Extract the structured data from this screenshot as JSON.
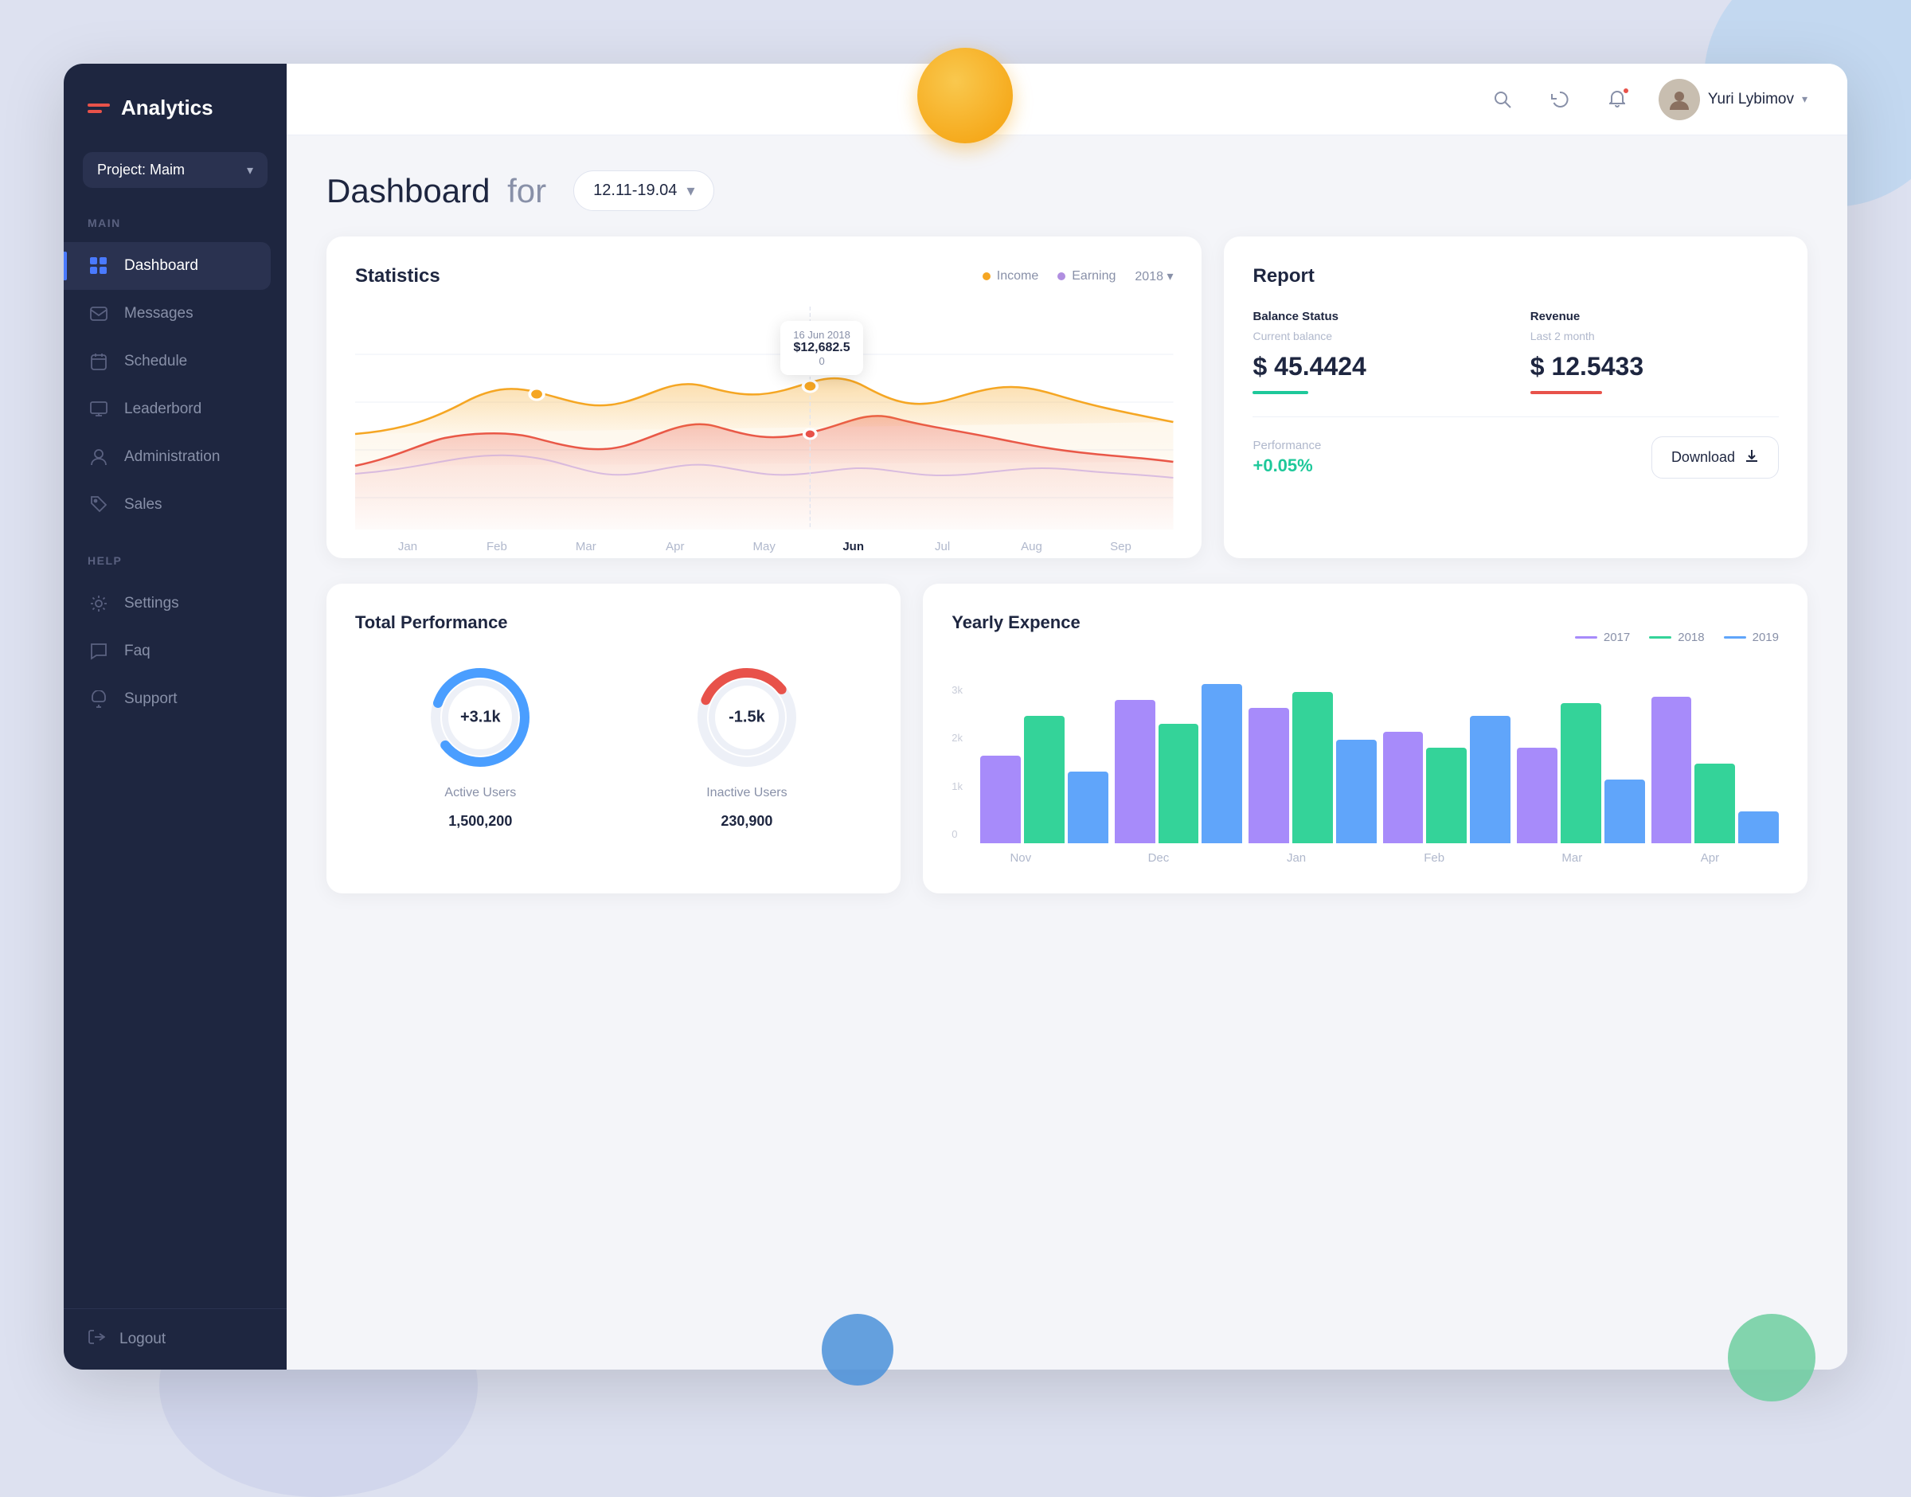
{
  "app": {
    "name": "Analytics",
    "project": "Project: Maim",
    "user": "Yuri Lybimov"
  },
  "sidebar": {
    "nav_main_label": "MAIN",
    "nav_help_label": "HELP",
    "items_main": [
      {
        "id": "dashboard",
        "label": "Dashboard",
        "icon": "grid"
      },
      {
        "id": "messages",
        "label": "Messages",
        "icon": "mail"
      },
      {
        "id": "schedule",
        "label": "Schedule",
        "icon": "calendar"
      },
      {
        "id": "leaderboard",
        "label": "Leaderbord",
        "icon": "monitor"
      },
      {
        "id": "administration",
        "label": "Administration",
        "icon": "person"
      },
      {
        "id": "sales",
        "label": "Sales",
        "icon": "tag"
      }
    ],
    "items_help": [
      {
        "id": "settings",
        "label": "Settings",
        "icon": "gear"
      },
      {
        "id": "faq",
        "label": "Faq",
        "icon": "chat"
      },
      {
        "id": "support",
        "label": "Support",
        "icon": "bell"
      }
    ],
    "logout_label": "Logout"
  },
  "topbar": {
    "search_title": "Search",
    "refresh_title": "Refresh",
    "notifications_title": "Notifications"
  },
  "dashboard": {
    "title": "Dashboard",
    "for_label": "for",
    "date_range": "12.11-19.04",
    "statistics": {
      "title": "Statistics",
      "legend_income": "Income",
      "legend_earning": "Earning",
      "year": "2018",
      "tooltip_date": "16 Jun 2018",
      "tooltip_amount": "$12,682.5",
      "tooltip_sub": "0",
      "x_labels": [
        "Jan",
        "Feb",
        "Mar",
        "Apr",
        "May",
        "Jun",
        "Jul",
        "Aug",
        "Sep"
      ]
    },
    "report": {
      "title": "Report",
      "balance_status_label": "Balance Status",
      "revenue_label": "Revenue",
      "current_balance_label": "Current balance",
      "last_2_month_label": "Last 2 month",
      "balance_amount": "$ 45.4424",
      "revenue_amount": "$ 12.5433",
      "performance_label": "Performance",
      "performance_value": "+0.05%",
      "download_label": "Download"
    },
    "total_performance": {
      "title": "Total Performance",
      "active_users_value": "+3.1k",
      "active_users_label": "Active Users",
      "active_users_count": "1,500,200",
      "inactive_users_value": "-1.5k",
      "inactive_users_label": "Inactive Users",
      "inactive_users_count": "230,900"
    },
    "yearly_expense": {
      "title": "Yearly Expence",
      "legend_2017": "2017",
      "legend_2018": "2018",
      "legend_2019": "2019",
      "y_labels": [
        "3k",
        "2k",
        "1k",
        "0"
      ],
      "x_labels": [
        "Nov",
        "Dec",
        "Jan",
        "Feb",
        "Mar",
        "Apr"
      ],
      "bars": [
        {
          "month": "Nov",
          "v2017": 55,
          "v2018": 80,
          "v2019": 45
        },
        {
          "month": "Dec",
          "v2017": 90,
          "v2018": 75,
          "v2019": 100
        },
        {
          "month": "Jan",
          "v2017": 85,
          "v2018": 95,
          "v2019": 65
        },
        {
          "month": "Feb",
          "v2017": 70,
          "v2018": 60,
          "v2019": 80
        },
        {
          "month": "Mar",
          "v2017": 60,
          "v2018": 88,
          "v2019": 40
        },
        {
          "month": "Apr",
          "v2017": 92,
          "v2018": 50,
          "v2019": 20
        }
      ]
    }
  }
}
